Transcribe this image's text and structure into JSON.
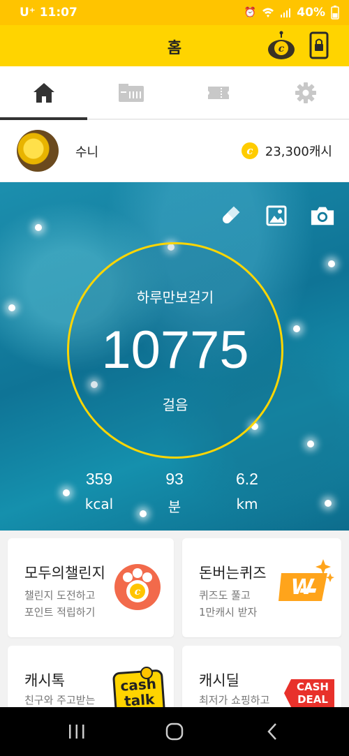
{
  "status_bar": {
    "carrier": "U⁺",
    "time": "11:07",
    "battery": "40%"
  },
  "header": {
    "title": "홈",
    "coin_icon": "coin-antenna-icon",
    "lock_icon": "phone-lock-icon"
  },
  "tabs": [
    {
      "name": "home",
      "icon": "home-icon"
    },
    {
      "name": "benefits",
      "icon": "store-icon"
    },
    {
      "name": "coupons",
      "icon": "ticket-icon"
    },
    {
      "name": "settings",
      "icon": "gear-icon"
    }
  ],
  "profile": {
    "name": "수니",
    "cash": "23,300캐시"
  },
  "hero": {
    "label": "하루만보걷기",
    "steps": "10775",
    "steps_unit": "걸음",
    "stats": [
      {
        "value": "359",
        "label": "kcal"
      },
      {
        "value": "93",
        "label": "분"
      },
      {
        "value": "6.2",
        "label": "km"
      }
    ],
    "ring_color": "#ffd600"
  },
  "cards": [
    {
      "title": "모두의챌린지",
      "subtitle_1": "챌린지 도전하고",
      "subtitle_2": "포인트 적립하기",
      "icon": "paw-coin-icon"
    },
    {
      "title": "돈버는퀴즈",
      "subtitle_1": "퀴즈도 풀고",
      "subtitle_2": "1만캐시 받자",
      "icon": "quiz-w-icon"
    },
    {
      "title": "캐시톡",
      "subtitle_1": "친구와 주고받는",
      "logo_line1": "cash",
      "logo_line2": "talk",
      "icon": "cashtalk-logo-icon"
    },
    {
      "title": "캐시딜",
      "subtitle_1": "최저가 쇼핑하고",
      "logo_line1": "CASH",
      "logo_line2": "DEAL",
      "icon": "cashdeal-tag-icon"
    }
  ],
  "colors": {
    "accent": "#ffd400",
    "status": "#ffc400",
    "text": "#222222"
  }
}
